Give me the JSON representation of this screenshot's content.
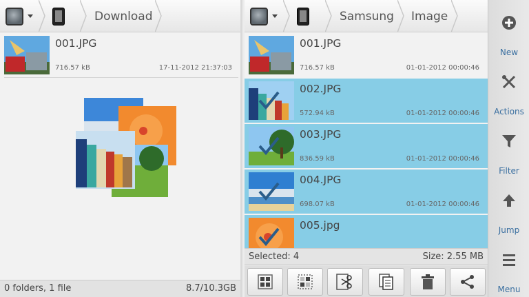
{
  "left_pane": {
    "breadcrumb": [
      "Download"
    ],
    "files": [
      {
        "name": "001.JPG",
        "size": "716.57 kB",
        "date": "17-11-2012 21:37:03"
      }
    ],
    "status_left": "0 folders, 1 file",
    "status_right": "8.7/10.3GB"
  },
  "right_pane": {
    "breadcrumb": [
      "Samsung",
      "Image"
    ],
    "files": [
      {
        "name": "001.JPG",
        "size": "716.57 kB",
        "date": "01-01-2012 00:00:46",
        "selected": false
      },
      {
        "name": "002.JPG",
        "size": "572.94 kB",
        "date": "01-01-2012 00:00:46",
        "selected": true
      },
      {
        "name": "003.JPG",
        "size": "836.59 kB",
        "date": "01-01-2012 00:00:46",
        "selected": true
      },
      {
        "name": "004.JPG",
        "size": "698.07 kB",
        "date": "01-01-2012 00:00:46",
        "selected": true
      },
      {
        "name": "005.jpg",
        "size": "",
        "date": "",
        "selected": true
      }
    ],
    "selected_text": "Selected: 4",
    "size_text": "Size: 2.55 MB",
    "toolbar_icons": [
      "select-all-icon",
      "deselect-icon",
      "cut-icon",
      "copy-icon",
      "delete-icon",
      "share-icon"
    ]
  },
  "side_rail": [
    {
      "label": "New",
      "icon": "plus-circle-icon"
    },
    {
      "label": "Actions",
      "icon": "tools-icon"
    },
    {
      "label": "Filter",
      "icon": "funnel-icon"
    },
    {
      "label": "Jump",
      "icon": "up-arrow-icon"
    },
    {
      "label": "Menu",
      "icon": "menu-icon"
    }
  ],
  "colors": {
    "selection": "#87cde6",
    "rail_label": "#3a6fa0"
  }
}
